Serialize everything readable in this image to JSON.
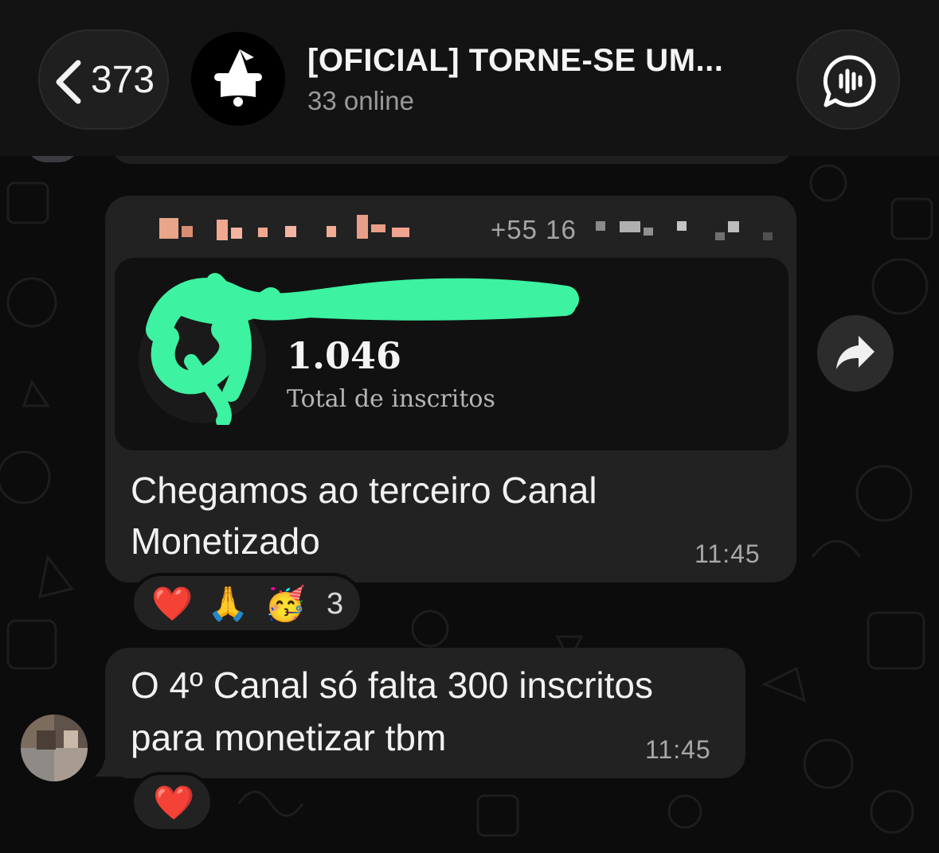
{
  "header": {
    "back_count": "373",
    "title": "[OFICIAL] TORNE-SE UM...",
    "subtitle": "33 online",
    "back_icon": "chevron-left-icon",
    "group_icon": "wizard-hat-icon",
    "voice_icon": "voice-chat-icon"
  },
  "message1": {
    "sender_phone": "+55 16",
    "card": {
      "count": "1.046",
      "label": "Total de inscritos"
    },
    "text": "Chegamos ao terceiro Canal Monetizado",
    "time": "11:45",
    "reactions": [
      "❤️",
      "🙏",
      "🥳"
    ],
    "reaction_count": "3",
    "forward_icon": "forward-arrow-icon"
  },
  "message2": {
    "text": "O 4º Canal só falta 300 inscritos para monetizar tbm",
    "time": "11:45",
    "reactions": [
      "❤️"
    ]
  },
  "colors": {
    "bubble": "#222222",
    "header": "#131313",
    "background": "#0c0c0c",
    "scribble": "#3df2a0"
  }
}
